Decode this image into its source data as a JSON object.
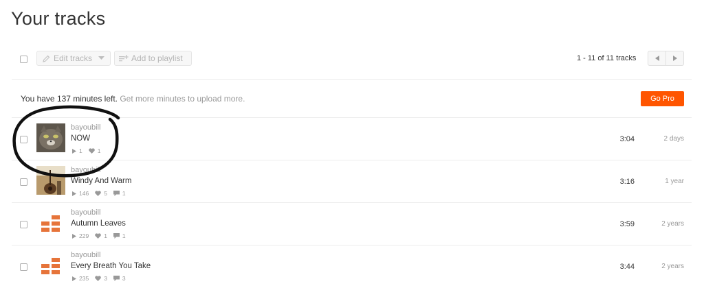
{
  "page": {
    "title": "Your tracks"
  },
  "toolbar": {
    "edit_label": "Edit tracks",
    "playlist_label": "Add to playlist",
    "pagination": "1 - 11 of 11 tracks"
  },
  "notice": {
    "text_main": "You have 137 minutes left.",
    "text_muted": "Get more minutes to upload more.",
    "go_pro_label": "Go Pro",
    "accent": "#ff5500"
  },
  "tracks": [
    {
      "artist": "bayoubill",
      "title": "NOW",
      "plays": "1",
      "likes": "1",
      "comments": "",
      "duration": "3:04",
      "age": "2 days",
      "art": "cat-photo"
    },
    {
      "artist": "bayoubill",
      "title": "Windy And Warm",
      "plays": "146",
      "likes": "5",
      "comments": "1",
      "duration": "3:16",
      "age": "1 year",
      "art": "guitar-photo"
    },
    {
      "artist": "bayoubill",
      "title": "Autumn Leaves",
      "plays": "229",
      "likes": "1",
      "comments": "1",
      "duration": "3:59",
      "age": "2 years",
      "art": "placeholder-art-icon"
    },
    {
      "artist": "bayoubill",
      "title": "Every Breath You Take",
      "plays": "235",
      "likes": "3",
      "comments": "3",
      "duration": "3:44",
      "age": "2 years",
      "art": "placeholder-art-icon"
    }
  ]
}
